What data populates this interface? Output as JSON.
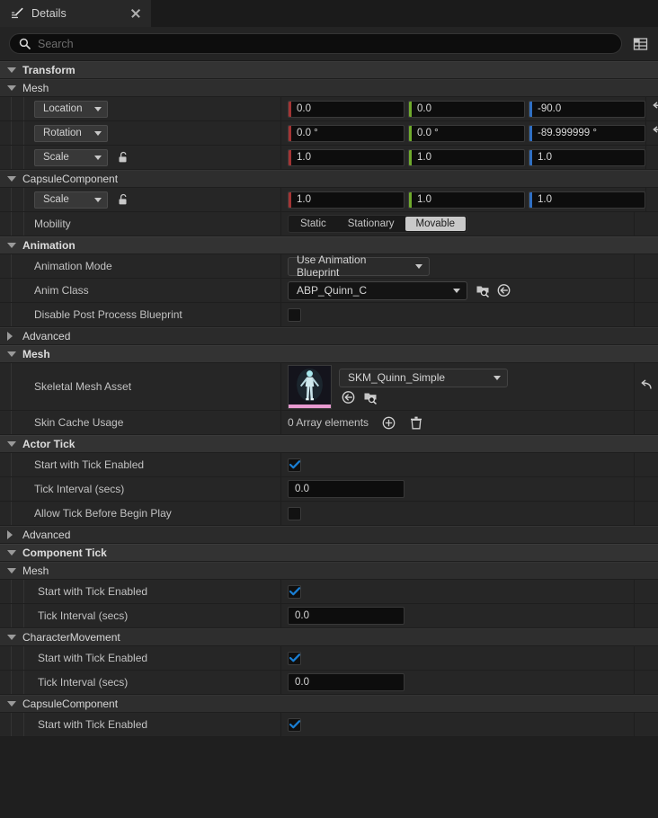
{
  "tab": {
    "label": "Details",
    "icon": "details-pen-icon",
    "close_icon": "close-icon"
  },
  "search": {
    "placeholder": "Search",
    "icon": "search-icon",
    "settings_icon": "column-settings-icon"
  },
  "colors": {
    "axis_x": "#a33434",
    "axis_y": "#6faa2c",
    "axis_z": "#2f6fc4",
    "accent_check": "#1a7fd4",
    "thumb_accent": "#e79ad0",
    "panel_bg": "#262626",
    "category_bg": "#333333"
  },
  "sections": {
    "transform": {
      "title": "Transform"
    },
    "transform_mesh": {
      "title": "Mesh"
    },
    "capsule": {
      "title": "CapsuleComponent"
    },
    "animation": {
      "title": "Animation"
    },
    "mesh": {
      "title": "Mesh"
    },
    "actor_tick": {
      "title": "Actor Tick"
    },
    "component_tick": {
      "title": "Component Tick"
    },
    "ct_mesh": {
      "title": "Mesh"
    },
    "ct_charmove": {
      "title": "CharacterMovement"
    },
    "ct_capsule": {
      "title": "CapsuleComponent"
    }
  },
  "transform": {
    "location": {
      "label": "Location",
      "x": "0.0",
      "y": "0.0",
      "z": "-90.0",
      "reset_icon": "reset-arrow-icon"
    },
    "rotation": {
      "label": "Rotation",
      "x": "0.0 °",
      "y": "0.0 °",
      "z": "-89.999999 °",
      "reset_icon": "reset-arrow-icon"
    },
    "scale": {
      "label": "Scale",
      "x": "1.0",
      "y": "1.0",
      "z": "1.0",
      "lock_icon": "unlock-icon"
    }
  },
  "capsule": {
    "scale": {
      "label": "Scale",
      "x": "1.0",
      "y": "1.0",
      "z": "1.0",
      "lock_icon": "unlock-icon"
    },
    "mobility": {
      "label": "Mobility",
      "options": [
        "Static",
        "Stationary",
        "Movable"
      ],
      "selected": "Movable"
    }
  },
  "animation": {
    "mode": {
      "label": "Animation Mode",
      "value": "Use Animation Blueprint"
    },
    "anim_class": {
      "label": "Anim Class",
      "value": "ABP_Quinn_C",
      "browse_icon": "browse-asset-icon",
      "use_icon": "use-selected-asset-icon"
    },
    "disable_ppbp": {
      "label": "Disable Post Process Blueprint",
      "checked": false
    },
    "advanced": {
      "label": "Advanced"
    }
  },
  "mesh": {
    "skeletal_mesh_asset": {
      "label": "Skeletal Mesh Asset",
      "value": "SKM_Quinn_Simple",
      "thumbnail_icon": "character-thumbnail",
      "use_icon": "use-selected-asset-icon",
      "browse_icon": "browse-asset-icon",
      "reset_icon": "reset-arrow-icon"
    },
    "skin_cache_usage": {
      "label": "Skin Cache Usage",
      "value": "0 Array elements",
      "add_icon": "add-element-icon",
      "delete_icon": "delete-all-icon"
    }
  },
  "actor_tick": {
    "start_with_tick": {
      "label": "Start with Tick Enabled",
      "checked": true
    },
    "tick_interval": {
      "label": "Tick Interval (secs)",
      "value": "0.0"
    },
    "allow_before_begin": {
      "label": "Allow Tick Before Begin Play",
      "checked": false
    },
    "advanced": {
      "label": "Advanced"
    }
  },
  "component_tick": {
    "mesh": {
      "start_with_tick": {
        "label": "Start with Tick Enabled",
        "checked": true
      },
      "tick_interval": {
        "label": "Tick Interval (secs)",
        "value": "0.0"
      }
    },
    "charactermovement": {
      "start_with_tick": {
        "label": "Start with Tick Enabled",
        "checked": true
      },
      "tick_interval": {
        "label": "Tick Interval (secs)",
        "value": "0.0"
      }
    },
    "capsulecomponent": {
      "start_with_tick": {
        "label": "Start with Tick Enabled",
        "checked": true
      }
    }
  }
}
